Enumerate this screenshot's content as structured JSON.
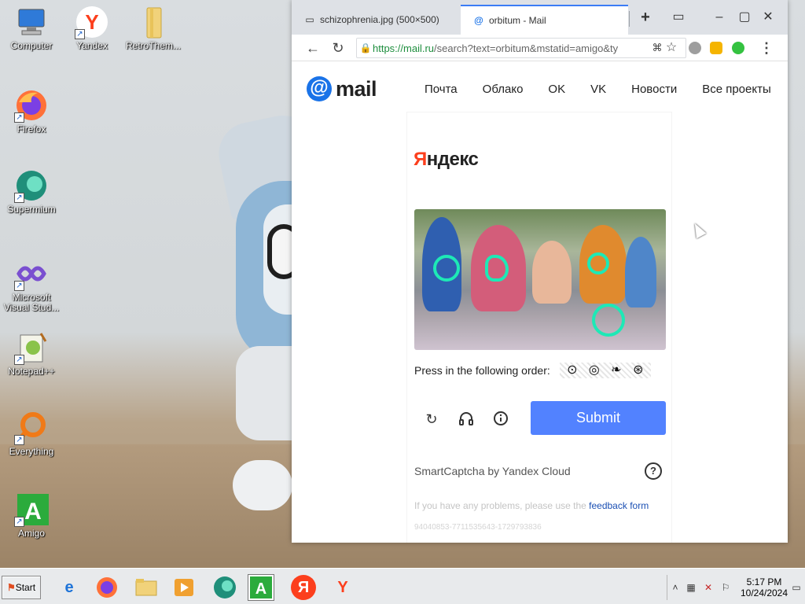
{
  "desktop": {
    "icons": [
      {
        "label": "Computer",
        "icon": "computer-icon"
      },
      {
        "label": "Yandex",
        "icon": "yandex-browser-icon"
      },
      {
        "label": "RetroThem...",
        "icon": "folder-icon"
      },
      {
        "label": "Firefox",
        "icon": "firefox-icon"
      },
      {
        "label": "Supermium",
        "icon": "supermium-icon"
      },
      {
        "label": "Microsoft Visual Stud...",
        "icon": "visual-studio-icon"
      },
      {
        "label": "Notepad++",
        "icon": "notepad-plus-plus-icon"
      },
      {
        "label": "Everything",
        "icon": "everything-icon"
      },
      {
        "label": "Amigo",
        "icon": "amigo-icon"
      }
    ]
  },
  "browser": {
    "tabs": [
      {
        "title": "schizophrenia.jpg (500×500)",
        "active": false
      },
      {
        "title": "orbitum - Mail",
        "active": true
      }
    ],
    "new_tab": "+",
    "url_host": "https://mail.ru",
    "url_rest": "/search?text=orbitum&mstatid=amigo&ty"
  },
  "mailru": {
    "logo_at": "@",
    "logo_word": "mail",
    "nav": [
      "Почта",
      "Облако",
      "OK",
      "VK",
      "Новости",
      "Все проекты"
    ]
  },
  "captcha": {
    "brand_first": "Я",
    "brand_rest": "ндекс",
    "instruction": "Press in the following order:",
    "order_symbols": [
      "⊙",
      "◎",
      "❧",
      "⊛"
    ],
    "submit_label": "Submit",
    "powered_by": "SmartCaptcha by Yandex Cloud",
    "help_label": "?",
    "problems_text": "If you have any problems, please use the",
    "feedback_link": "feedback form",
    "request_id": "94040853-7711535643-1729793836"
  },
  "taskbar": {
    "start_label": "Start",
    "time": "5:17 PM",
    "date": "10/24/2024"
  },
  "colors": {
    "accent": "#5282ff",
    "yandex_red": "#fc3f1d",
    "mail_blue": "#1a73e8",
    "tab_active_border": "#3b7cf6"
  }
}
